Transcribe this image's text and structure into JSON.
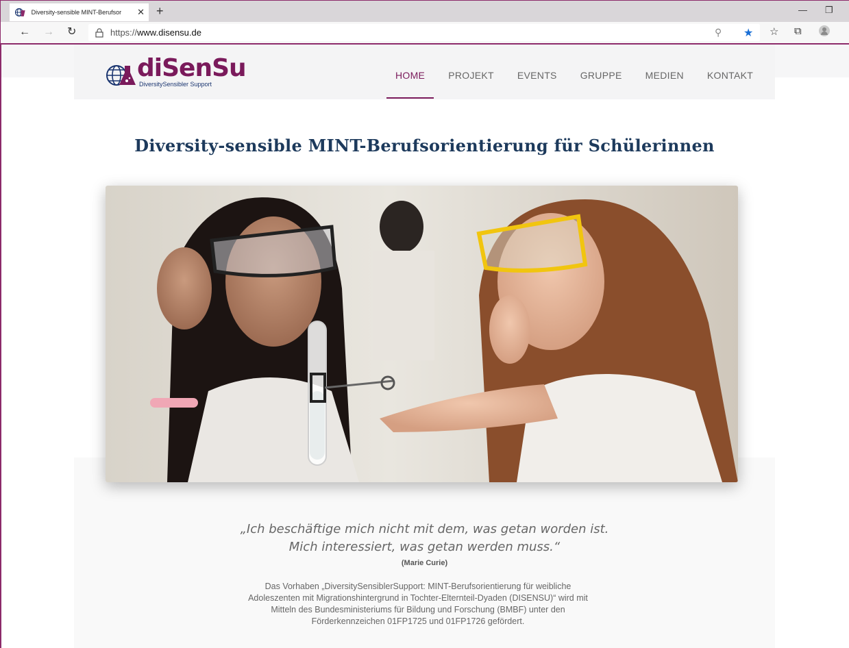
{
  "browser": {
    "tab_title": "Diversity-sensible MINT-Berufsor",
    "new_tab": "+",
    "url_prefix": "https://",
    "url_host": "www.disensu.de"
  },
  "site": {
    "logo_text": "diSenSu",
    "logo_subtitle": "DiversitySensibler Support",
    "nav": [
      {
        "label": "HOME",
        "active": true
      },
      {
        "label": "PROJEKT"
      },
      {
        "label": "EVENTS"
      },
      {
        "label": "GRUPPE"
      },
      {
        "label": "MEDIEN"
      },
      {
        "label": "KONTAKT"
      }
    ],
    "headline": "Diversity-sensible MINT-Berufsorientierung für Schülerinnen",
    "quote_line1": "„Ich beschäftige mich nicht mit dem, was getan worden ist.",
    "quote_line2": "Mich interessiert, was getan werden muss.“",
    "quote_author": "(Marie Curie)",
    "description_line1": "Das Vorhaben „DiversitySensiblerSupport: MINT-Berufsorientierung für weibliche",
    "description_line2": "Adoleszenten mit Migrationshintergrund in Tochter-Elternteil-Dyaden (DISENSU)“ wird mit",
    "description_line3": "Mitteln des Bundesministeriums für Bildung und Forschung (BMBF) unter den",
    "description_line4": "Förderkennzeichen 01FP1725 und 01FP1726 gefördert."
  },
  "colors": {
    "brand": "#7a1a5b",
    "headline": "#1d3a5c",
    "frame": "#8c2a6a"
  }
}
